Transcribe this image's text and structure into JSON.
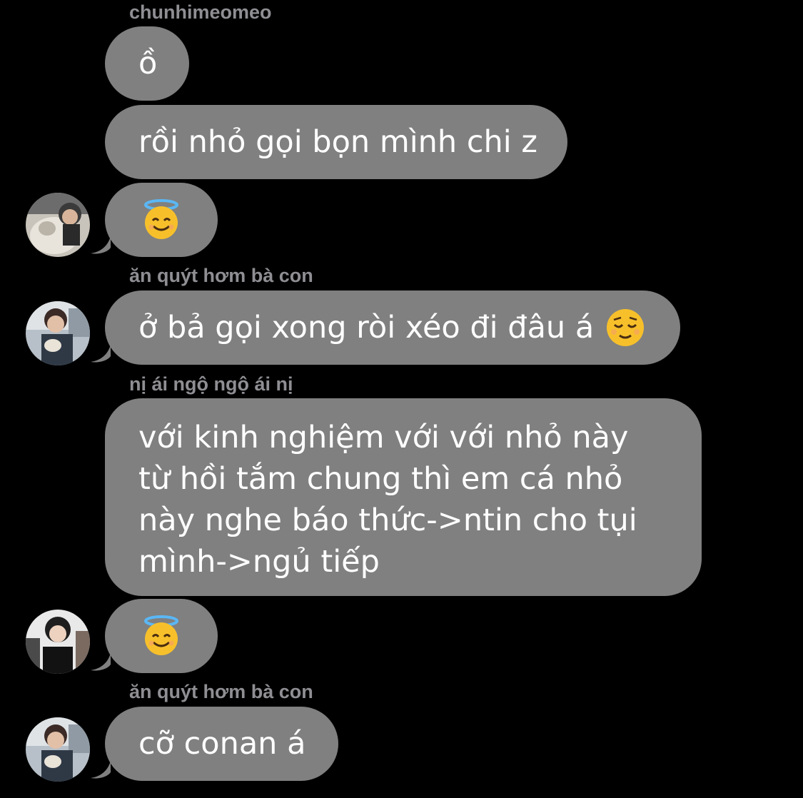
{
  "messages": [
    {
      "sender": "chunhimeomeo",
      "text": "ồ"
    },
    {
      "text": "rồi nhỏ gọi bọn mình chi z"
    },
    {
      "emoji": "smiling-face-with-halo-icon"
    },
    {
      "sender": "ăn quýt hơm bà con",
      "text": "ở bả gọi xong ròi xéo đi đâu á",
      "trailing_emoji": "relieved-face-icon"
    },
    {
      "sender": "nị ái ngộ ngộ ái nị",
      "text": "với kinh nghiệm với với nhỏ này từ hồi tắm chung thì em cá nhỏ này nghe báo thức->ntin cho tụi mình->ngủ tiếp"
    },
    {
      "emoji": "smiling-face-with-halo-icon"
    },
    {
      "sender": "ăn quýt hơm bà con",
      "text": "cỡ conan á"
    }
  ],
  "colors": {
    "background": "#000000",
    "bubble": "#808080",
    "sender_name": "#8e8e93",
    "text": "#ffffff"
  }
}
